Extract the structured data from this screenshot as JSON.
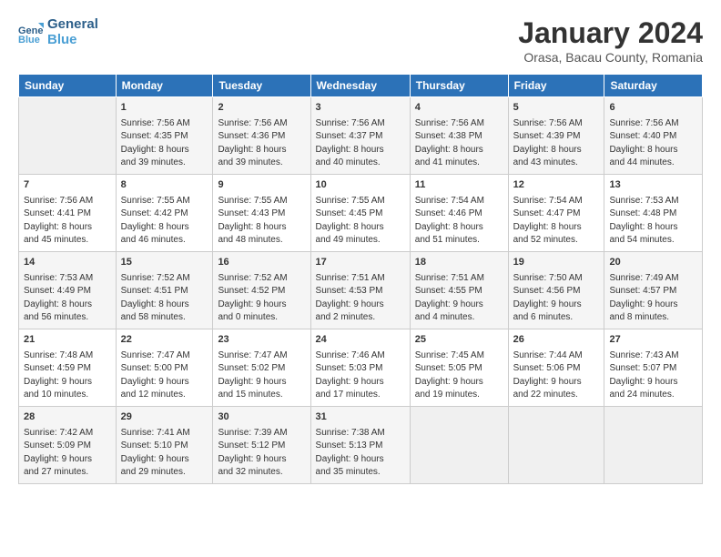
{
  "logo": {
    "line1": "General",
    "line2": "Blue"
  },
  "title": "January 2024",
  "subtitle": "Orasa, Bacau County, Romania",
  "headers": [
    "Sunday",
    "Monday",
    "Tuesday",
    "Wednesday",
    "Thursday",
    "Friday",
    "Saturday"
  ],
  "weeks": [
    [
      {
        "day": "",
        "content": ""
      },
      {
        "day": "1",
        "content": "Sunrise: 7:56 AM\nSunset: 4:35 PM\nDaylight: 8 hours\nand 39 minutes."
      },
      {
        "day": "2",
        "content": "Sunrise: 7:56 AM\nSunset: 4:36 PM\nDaylight: 8 hours\nand 39 minutes."
      },
      {
        "day": "3",
        "content": "Sunrise: 7:56 AM\nSunset: 4:37 PM\nDaylight: 8 hours\nand 40 minutes."
      },
      {
        "day": "4",
        "content": "Sunrise: 7:56 AM\nSunset: 4:38 PM\nDaylight: 8 hours\nand 41 minutes."
      },
      {
        "day": "5",
        "content": "Sunrise: 7:56 AM\nSunset: 4:39 PM\nDaylight: 8 hours\nand 43 minutes."
      },
      {
        "day": "6",
        "content": "Sunrise: 7:56 AM\nSunset: 4:40 PM\nDaylight: 8 hours\nand 44 minutes."
      }
    ],
    [
      {
        "day": "7",
        "content": "Sunrise: 7:56 AM\nSunset: 4:41 PM\nDaylight: 8 hours\nand 45 minutes."
      },
      {
        "day": "8",
        "content": "Sunrise: 7:55 AM\nSunset: 4:42 PM\nDaylight: 8 hours\nand 46 minutes."
      },
      {
        "day": "9",
        "content": "Sunrise: 7:55 AM\nSunset: 4:43 PM\nDaylight: 8 hours\nand 48 minutes."
      },
      {
        "day": "10",
        "content": "Sunrise: 7:55 AM\nSunset: 4:45 PM\nDaylight: 8 hours\nand 49 minutes."
      },
      {
        "day": "11",
        "content": "Sunrise: 7:54 AM\nSunset: 4:46 PM\nDaylight: 8 hours\nand 51 minutes."
      },
      {
        "day": "12",
        "content": "Sunrise: 7:54 AM\nSunset: 4:47 PM\nDaylight: 8 hours\nand 52 minutes."
      },
      {
        "day": "13",
        "content": "Sunrise: 7:53 AM\nSunset: 4:48 PM\nDaylight: 8 hours\nand 54 minutes."
      }
    ],
    [
      {
        "day": "14",
        "content": "Sunrise: 7:53 AM\nSunset: 4:49 PM\nDaylight: 8 hours\nand 56 minutes."
      },
      {
        "day": "15",
        "content": "Sunrise: 7:52 AM\nSunset: 4:51 PM\nDaylight: 8 hours\nand 58 minutes."
      },
      {
        "day": "16",
        "content": "Sunrise: 7:52 AM\nSunset: 4:52 PM\nDaylight: 9 hours\nand 0 minutes."
      },
      {
        "day": "17",
        "content": "Sunrise: 7:51 AM\nSunset: 4:53 PM\nDaylight: 9 hours\nand 2 minutes."
      },
      {
        "day": "18",
        "content": "Sunrise: 7:51 AM\nSunset: 4:55 PM\nDaylight: 9 hours\nand 4 minutes."
      },
      {
        "day": "19",
        "content": "Sunrise: 7:50 AM\nSunset: 4:56 PM\nDaylight: 9 hours\nand 6 minutes."
      },
      {
        "day": "20",
        "content": "Sunrise: 7:49 AM\nSunset: 4:57 PM\nDaylight: 9 hours\nand 8 minutes."
      }
    ],
    [
      {
        "day": "21",
        "content": "Sunrise: 7:48 AM\nSunset: 4:59 PM\nDaylight: 9 hours\nand 10 minutes."
      },
      {
        "day": "22",
        "content": "Sunrise: 7:47 AM\nSunset: 5:00 PM\nDaylight: 9 hours\nand 12 minutes."
      },
      {
        "day": "23",
        "content": "Sunrise: 7:47 AM\nSunset: 5:02 PM\nDaylight: 9 hours\nand 15 minutes."
      },
      {
        "day": "24",
        "content": "Sunrise: 7:46 AM\nSunset: 5:03 PM\nDaylight: 9 hours\nand 17 minutes."
      },
      {
        "day": "25",
        "content": "Sunrise: 7:45 AM\nSunset: 5:05 PM\nDaylight: 9 hours\nand 19 minutes."
      },
      {
        "day": "26",
        "content": "Sunrise: 7:44 AM\nSunset: 5:06 PM\nDaylight: 9 hours\nand 22 minutes."
      },
      {
        "day": "27",
        "content": "Sunrise: 7:43 AM\nSunset: 5:07 PM\nDaylight: 9 hours\nand 24 minutes."
      }
    ],
    [
      {
        "day": "28",
        "content": "Sunrise: 7:42 AM\nSunset: 5:09 PM\nDaylight: 9 hours\nand 27 minutes."
      },
      {
        "day": "29",
        "content": "Sunrise: 7:41 AM\nSunset: 5:10 PM\nDaylight: 9 hours\nand 29 minutes."
      },
      {
        "day": "30",
        "content": "Sunrise: 7:39 AM\nSunset: 5:12 PM\nDaylight: 9 hours\nand 32 minutes."
      },
      {
        "day": "31",
        "content": "Sunrise: 7:38 AM\nSunset: 5:13 PM\nDaylight: 9 hours\nand 35 minutes."
      },
      {
        "day": "",
        "content": ""
      },
      {
        "day": "",
        "content": ""
      },
      {
        "day": "",
        "content": ""
      }
    ]
  ]
}
